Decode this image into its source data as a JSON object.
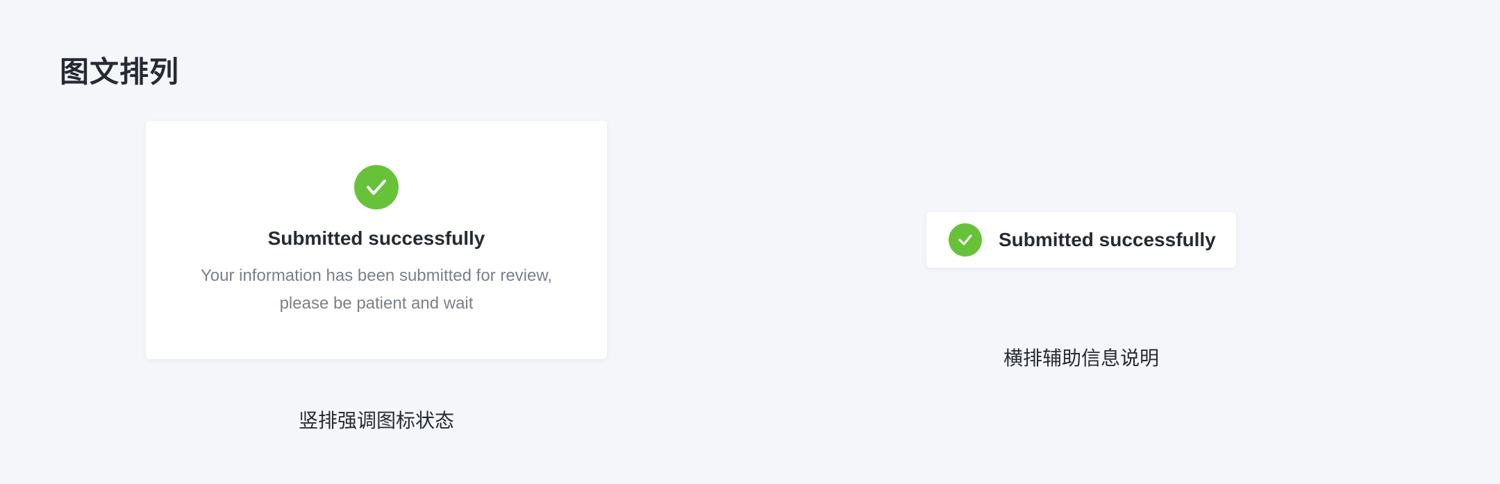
{
  "page": {
    "section_title": "图文排列"
  },
  "vertical_card": {
    "icon": "check-circle-icon",
    "title": "Submitted successfully",
    "description_line1": "Your information has been submitted for review,",
    "description_line2": "please be patient and wait",
    "caption": "竖排强调图标状态"
  },
  "horizontal_card": {
    "icon": "check-circle-icon",
    "title": "Submitted successfully",
    "caption": "横排辅助信息说明"
  },
  "colors": {
    "success": "#67c23a",
    "background": "#f5f6fa",
    "text_primary": "#262a33",
    "text_secondary": "#7a7f8c"
  }
}
